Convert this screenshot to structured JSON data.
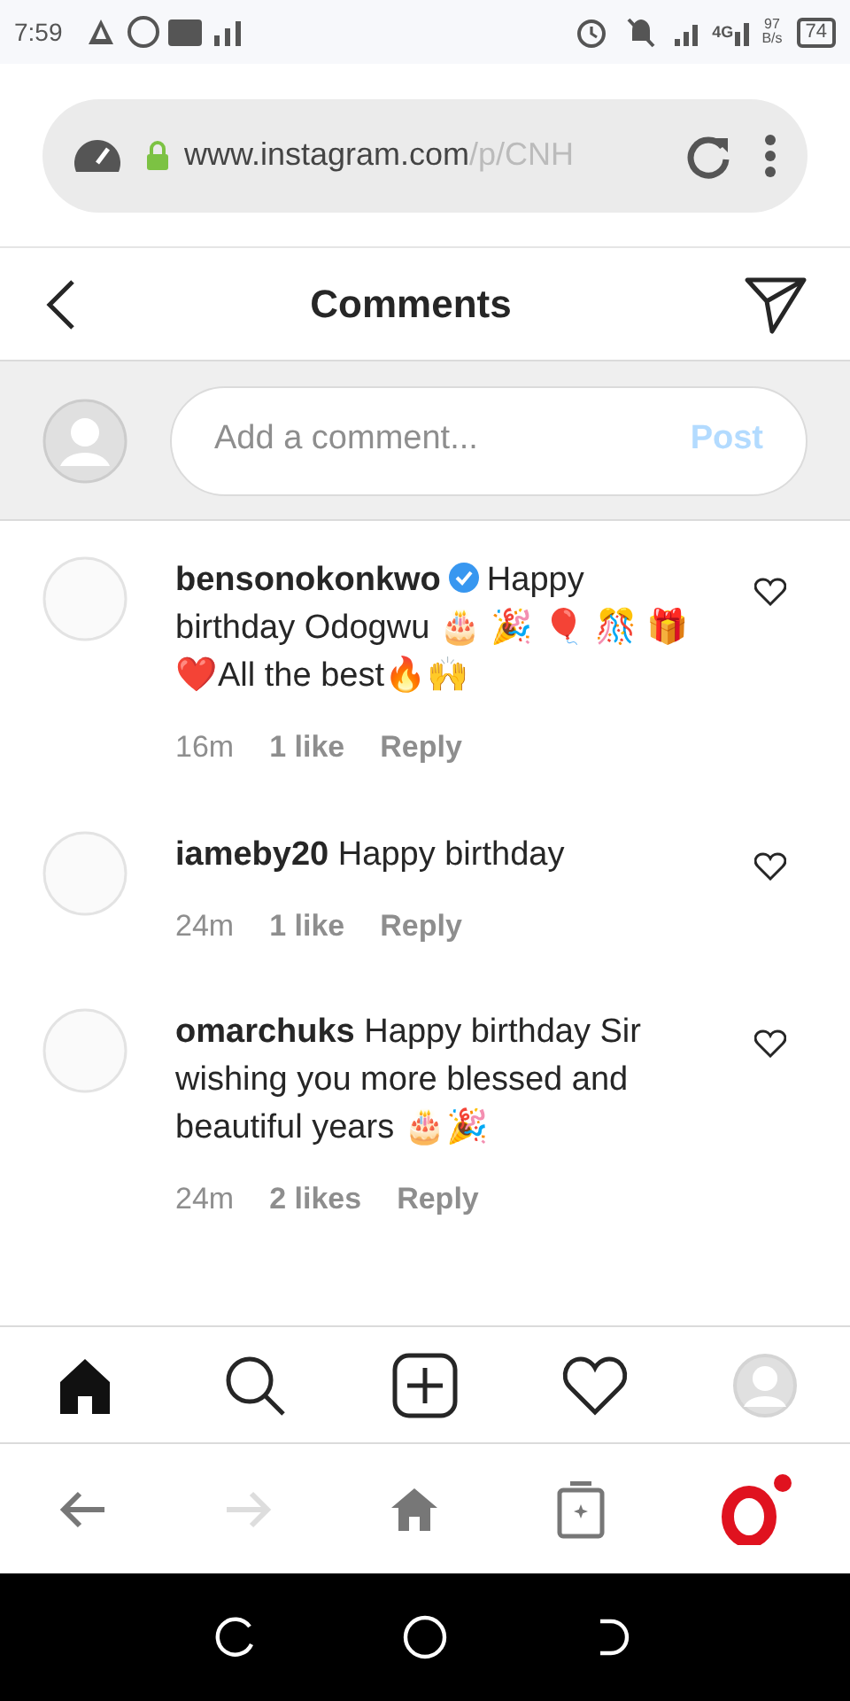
{
  "status_bar": {
    "time": "7:59",
    "network": "4G",
    "speed": "97",
    "speed_unit": "B/s",
    "battery": "74"
  },
  "address_bar": {
    "secure": true,
    "domain": "www.instagram.com",
    "path": "/p/CNH"
  },
  "header": {
    "title": "Comments"
  },
  "comment_input": {
    "placeholder": "Add a comment...",
    "button": "Post",
    "disabled": true
  },
  "comments": [
    {
      "user": "bensonokonkwo",
      "verified": true,
      "text": "Happy birthday Odogwu 🎂 🎉 🎈 🎊 🎁 ❤️All the best🔥🙌",
      "time": "16m",
      "likes": "1 like",
      "reply": "Reply",
      "liked": false
    },
    {
      "user": "iameby20",
      "verified": false,
      "text": "Happy birthday",
      "time": "24m",
      "likes": "1 like",
      "reply": "Reply",
      "liked": false
    },
    {
      "user": "omarchuks",
      "verified": false,
      "text": "Happy birthday Sir wishing you more blessed and beautiful years 🎂🎉",
      "time": "24m",
      "likes": "2 likes",
      "reply": "Reply",
      "liked": false
    }
  ],
  "bottom_nav": [
    {
      "kind": "home",
      "selected": true
    },
    {
      "kind": "search",
      "selected": false
    },
    {
      "kind": "new",
      "selected": false
    },
    {
      "kind": "activity",
      "selected": false
    },
    {
      "kind": "profile",
      "selected": false
    }
  ]
}
